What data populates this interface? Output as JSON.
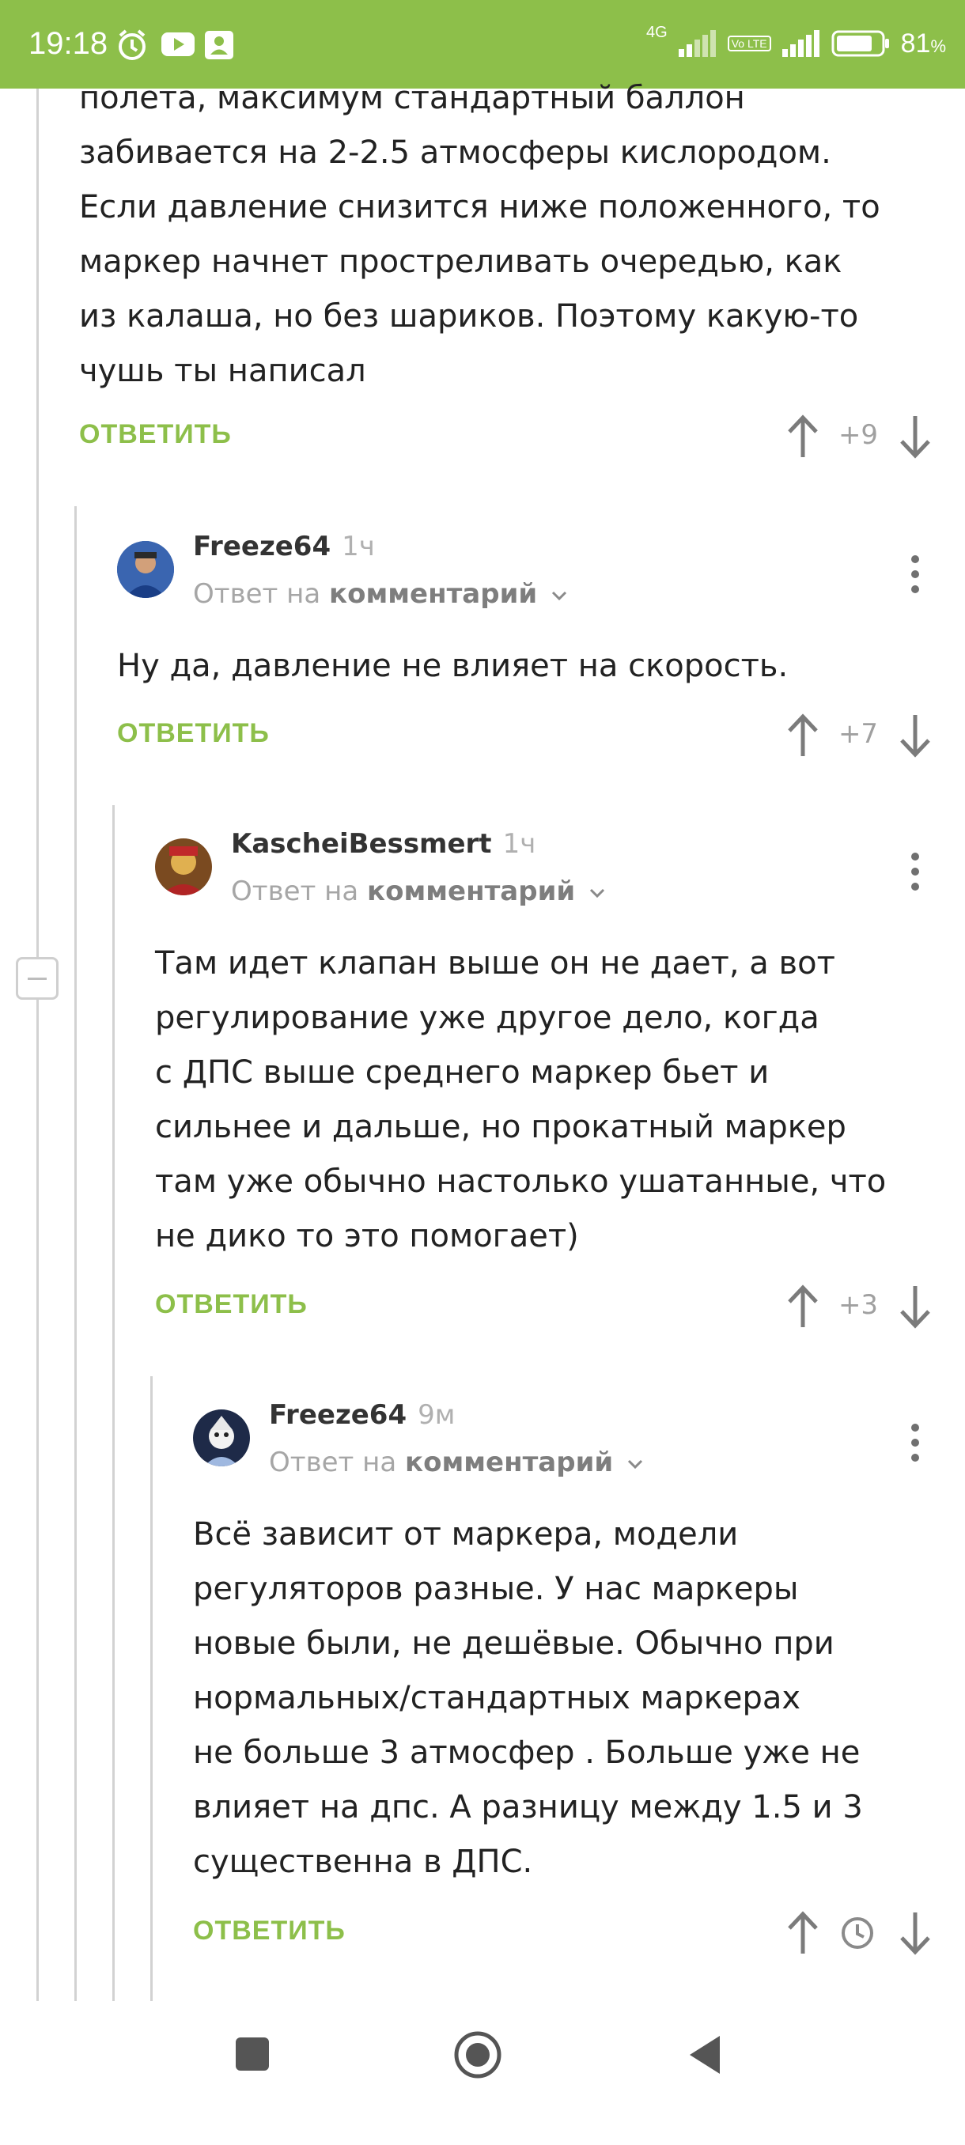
{
  "status_bar": {
    "time": "19:18",
    "icons_left": [
      "alarm-icon",
      "youtube-icon",
      "contacts-icon"
    ],
    "network": "4G",
    "volte": "Vo LTE",
    "battery": "81",
    "battery_unit": "%"
  },
  "comments": [
    {
      "body_lines": "полета, максимум стандартный баллон\nзабивается на 2-2.5 атмосферы кислородом.\nЕсли давление снизится ниже положенного, то\nмаркер начнет простреливать очередью, как\nиз калаша, но без шариков. Поэтому какую-то\nчушь ты написал",
      "reply_label": "ОТВЕТИТЬ",
      "rating": "+9"
    },
    {
      "author": "Freeze64",
      "time_ago": "1ч",
      "reply_to_prefix": "Ответ на",
      "reply_to_target": "комментарий",
      "body_lines": "Ну да, давление не влияет на скорость.",
      "reply_label": "ОТВЕТИТЬ",
      "rating": "+7"
    },
    {
      "author": "KascheiBessmert",
      "time_ago": "1ч",
      "reply_to_prefix": "Ответ на",
      "reply_to_target": "комментарий",
      "body_lines": "Там идет клапан выше он не дает, а вот\nрегулирование уже другое дело, когда\nс ДПС выше среднего маркер бьет и\nсильнее и дальше, но прокатный маркер\nтам уже обычно настолько ушатанные, что\nне дико то это помогает)",
      "reply_label": "ОТВЕТИТЬ",
      "rating": "+3"
    },
    {
      "author": "Freeze64",
      "time_ago": "9м",
      "reply_to_prefix": "Ответ на",
      "reply_to_target": "комментарий",
      "body_lines": "Всё зависит от маркера, модели\nрегуляторов разные. У нас маркеры\nновые были, не дешёвые. Обычно при\nнормальных/стандартных маркерах\nне больше 3 атмосфер . Больше уже не\nвлияет на дпс. А разницу между 1.5 и 3\nсущественна в ДПС.",
      "reply_label": "ОТВЕТИТЬ",
      "rating_icon": "clock-icon"
    }
  ],
  "nav_bar": {
    "buttons": [
      "recents-square-icon",
      "home-circle-icon",
      "back-triangle-icon"
    ]
  },
  "colors": {
    "accent_green": "#8dbf4a",
    "thread_line": "#d2d2d2",
    "muted_text": "#a6a6a6"
  }
}
